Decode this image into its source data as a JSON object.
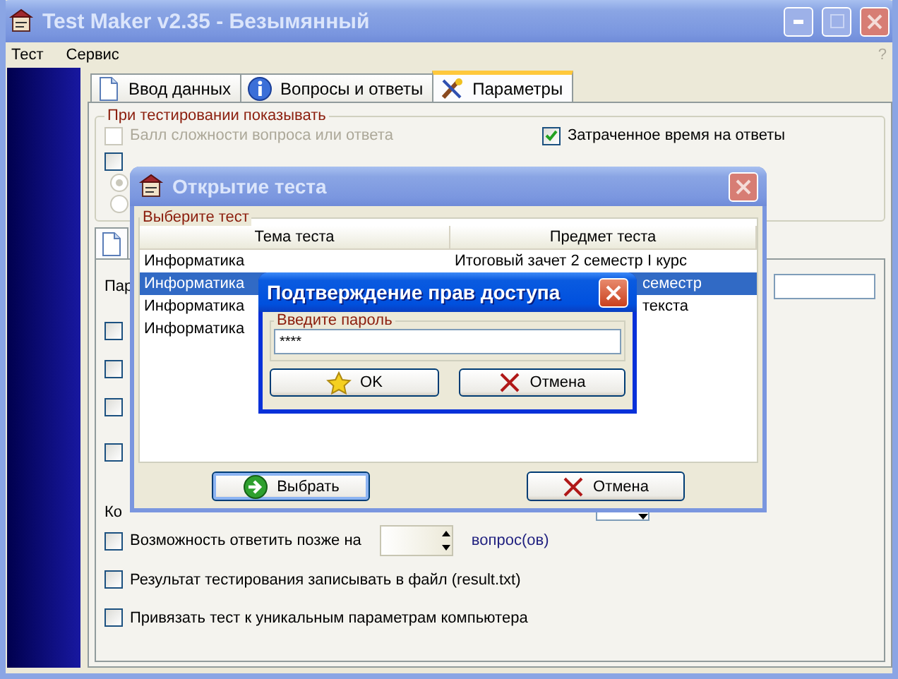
{
  "window": {
    "title": "Test Maker v2.35 - Безымянный"
  },
  "menu": [
    {
      "label": "Тест"
    },
    {
      "label": "Сервис"
    }
  ],
  "help_label": "?",
  "tabs": [
    {
      "label": "Ввод данных",
      "selected": false
    },
    {
      "label": "Вопросы и ответы",
      "selected": false
    },
    {
      "label": "Параметры",
      "selected": true
    }
  ],
  "display_group": {
    "title": "При тестировании показывать",
    "options": [
      {
        "label": "Балл сложности вопроса или ответа",
        "checked": false,
        "disabled": true
      },
      {
        "label": "Затраченное время на ответы",
        "checked": true,
        "disabled": false
      },
      {
        "checked": false,
        "disabled": false
      }
    ],
    "radios": [
      {
        "selected": true,
        "disabled": true
      },
      {
        "selected": false,
        "disabled": true
      }
    ]
  },
  "settings": {
    "password_label": "Пар",
    "unlabeled_checkboxes": [
      {
        "checked": false
      },
      {
        "checked": false
      },
      {
        "checked": false
      },
      {
        "checked": false
      }
    ],
    "count_label": "Ко",
    "answer_later": {
      "label": "Возможность ответить позже на",
      "checked": false,
      "unit": "вопрос(ов)"
    },
    "options": [
      {
        "label": "Результат тестирования записывать в файл (result.txt)",
        "checked": false
      },
      {
        "label": "Привязать тест к уникальным параметрам компьютера",
        "checked": false
      }
    ]
  },
  "open_dialog": {
    "title": "Открытие теста",
    "group": "Выберите тест",
    "columns": [
      "Тема теста",
      "Предмет теста"
    ],
    "rows": [
      {
        "cells": [
          "Информатика",
          "Итоговый зачет 2 семестр I курс"
        ],
        "selected": false,
        "partial": false
      },
      {
        "cells": [
          "Информатика",
          "семестр"
        ],
        "selected": true,
        "partial": true
      },
      {
        "cells": [
          "Информатика",
          "текста"
        ],
        "selected": false,
        "partial": true
      },
      {
        "cells": [
          "Информатика"
        ],
        "selected": false
      }
    ],
    "buttons": [
      {
        "label": "Выбрать"
      },
      {
        "label": "Отмена"
      }
    ]
  },
  "password_dialog": {
    "title": "Подтверждение прав доступа",
    "group": "Введите пароль",
    "value": "****",
    "buttons": [
      {
        "label": "OK"
      },
      {
        "label": "Отмена"
      }
    ]
  }
}
